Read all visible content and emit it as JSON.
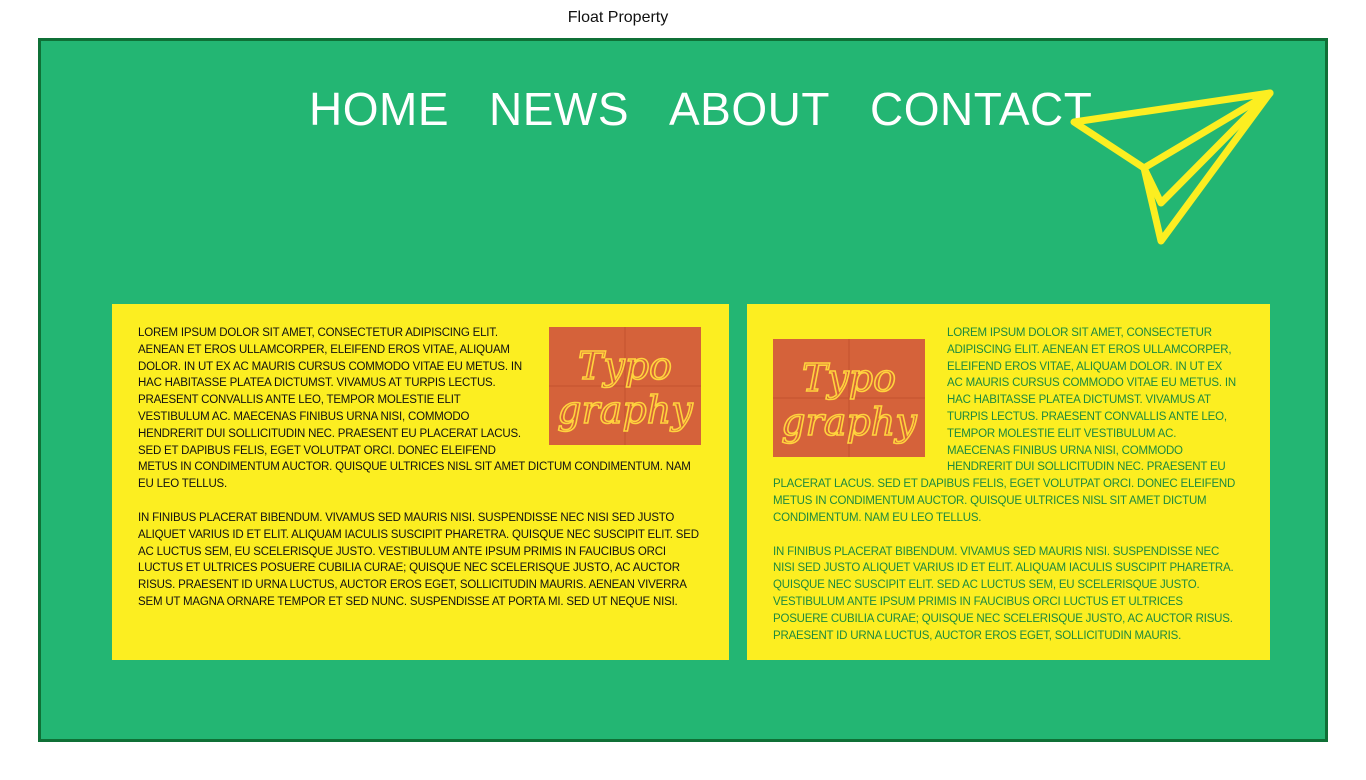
{
  "page": {
    "caption": "Float Property"
  },
  "nav": {
    "items": [
      {
        "label": "HOME"
      },
      {
        "label": "NEWS"
      },
      {
        "label": "ABOUT"
      },
      {
        "label": "CONTACT"
      }
    ]
  },
  "logo": {
    "icon": "paper-plane-icon",
    "color": "#fcee21"
  },
  "colors": {
    "frame_bg": "#23b673",
    "frame_border": "#0f7036",
    "card_bg": "#fcee21",
    "left_text": "#111111",
    "right_text": "#1e8a3e",
    "thumb_bg": "#d5623a",
    "neon": "#ffd33d"
  },
  "thumbnail": {
    "line1": "Typo",
    "line2": "graphy"
  },
  "card_left": {
    "paragraph1": "Lorem ipsum dolor sit amet, consectetur adipiscing elit. Aenean et eros ullamcorper, eleifend eros vitae, aliquam dolor. In ut ex ac mauris cursus commodo vitae eu metus. In hac habitasse platea dictumst. Vivamus at turpis lectus. Praesent convallis ante leo, tempor molestie elit vestibulum ac. Maecenas finibus urna nisi, commodo hendrerit dui sollicitudin nec. Praesent eu placerat lacus. Sed et dapibus felis, eget volutpat orci. Donec eleifend metus in condimentum auctor. Quisque ultrices nisl sit amet dictum condimentum. Nam eu leo tellus.",
    "paragraph2": "In finibus placerat bibendum. Vivamus sed mauris nisi. Suspendisse nec nisi sed justo aliquet varius id et elit. Aliquam iaculis suscipit pharetra. Quisque nec suscipit elit. Sed ac luctus sem, eu scelerisque justo. Vestibulum ante ipsum primis in faucibus orci luctus et ultrices posuere cubilia curae; Quisque nec scelerisque justo, ac auctor risus. Praesent id urna luctus, auctor eros eget, sollicitudin mauris. Aenean viverra sem ut magna ornare tempor et sed nunc. Suspendisse at porta mi. Sed ut neque nisi."
  },
  "card_right": {
    "paragraph1": "Lorem ipsum dolor sit amet, consectetur adipiscing elit. Aenean et eros ullamcorper, eleifend eros vitae, aliquam dolor. In ut ex ac mauris cursus commodo vitae eu metus. In hac habitasse platea dictumst. Vivamus at turpis lectus. Praesent convallis ante leo, tempor molestie elit vestibulum ac. Maecenas finibus urna nisi, commodo hendrerit dui sollicitudin nec. Praesent eu placerat lacus. Sed et dapibus felis, eget volutpat orci. Donec eleifend metus in condimentum auctor. Quisque ultrices nisl sit amet dictum condimentum. Nam eu leo tellus.",
    "paragraph2": "In finibus placerat bibendum. Vivamus sed mauris nisi. Suspendisse nec nisi sed justo aliquet varius id et elit. Aliquam iaculis suscipit pharetra. Quisque nec suscipit elit. Sed ac luctus sem, eu scelerisque justo. Vestibulum ante ipsum primis in faucibus orci luctus et ultrices posuere cubilia curae; Quisque nec scelerisque justo, ac auctor risus. Praesent id urna luctus, auctor eros eget, sollicitudin mauris."
  }
}
